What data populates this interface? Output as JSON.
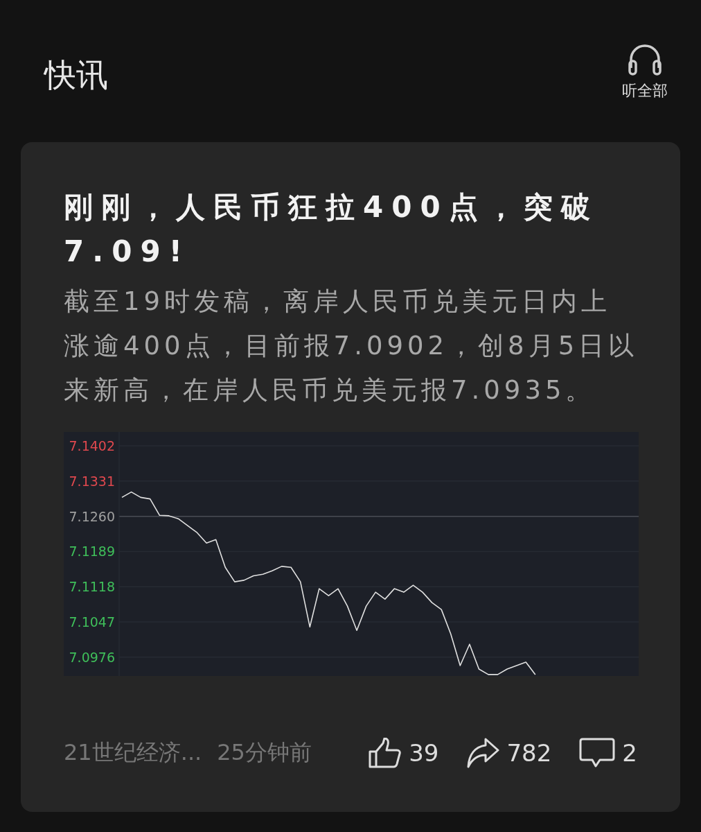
{
  "header": {
    "title": "快讯",
    "listen_label": "听全部"
  },
  "article": {
    "title": "刚刚，人民币狂拉400点，突破7.09!",
    "body": "截至19时发稿，离岸人民币兑美元日内上涨逾400点，目前报7.0902，创8月5日以来新高，在岸人民币兑美元报7.0935。",
    "chart_data": {
      "type": "line",
      "ylim": [
        7.0938,
        7.143
      ],
      "grid": true,
      "ref_lines": [
        {
          "axis": "y",
          "value": 7.126,
          "label": "7.1260"
        }
      ],
      "yticks": [
        7.1402,
        7.1331,
        7.1189,
        7.1118,
        7.1047,
        7.0976
      ],
      "series": [
        {
          "color": "#e0e0e0",
          "values": [
            7.1298,
            7.1309,
            7.1298,
            7.1295,
            7.1262,
            7.1261,
            7.1255,
            7.1241,
            7.1227,
            7.1206,
            7.1213,
            7.1157,
            7.1128,
            7.1131,
            7.114,
            7.1143,
            7.115,
            7.1159,
            7.1157,
            7.1128,
            7.1037,
            7.1114,
            7.11,
            7.1114,
            7.1079,
            7.103,
            7.1079,
            7.1107,
            7.1093,
            7.1114,
            7.1107,
            7.1121,
            7.1107,
            7.1086,
            7.1072,
            7.1023,
            7.0959,
            7.1002,
            7.0952,
            7.0941,
            7.0941,
            7.0952,
            7.0959,
            7.0966,
            7.0941,
            null,
            null,
            null,
            null,
            null,
            null,
            null,
            null,
            null,
            null,
            null
          ]
        }
      ]
    },
    "source": "21世纪经济...",
    "time": "25分钟前",
    "likes": "39",
    "shares": "782",
    "comments": "2"
  }
}
